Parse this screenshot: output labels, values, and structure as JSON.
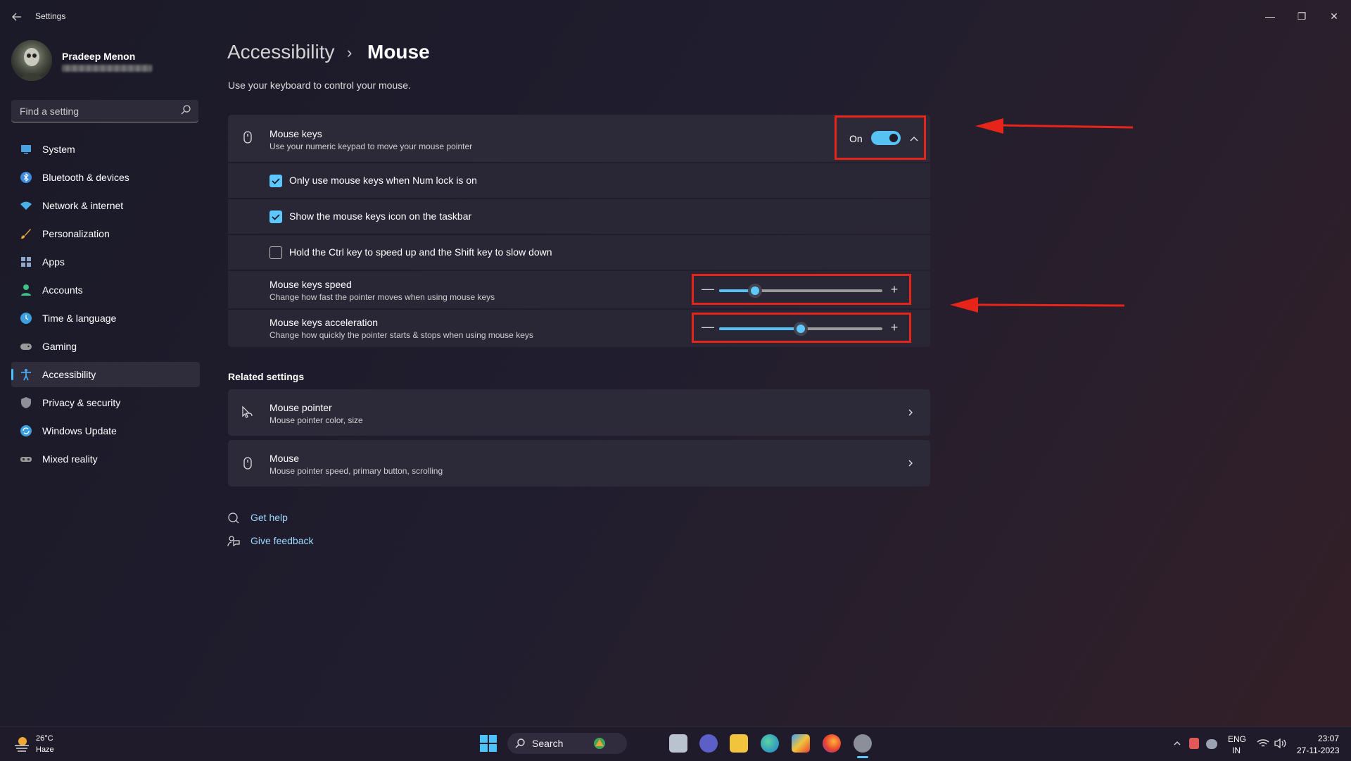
{
  "window": {
    "title": "Settings",
    "controls": {
      "minimize": "—",
      "maximize": "❐",
      "close": "✕"
    }
  },
  "profile": {
    "name": "Pradeep Menon"
  },
  "search": {
    "placeholder": "Find a setting"
  },
  "sidebar": {
    "items": [
      {
        "label": "System",
        "icon": "system-icon",
        "color": "#4aa3e0"
      },
      {
        "label": "Bluetooth & devices",
        "icon": "bluetooth-icon",
        "color": "#3d8be0"
      },
      {
        "label": "Network & internet",
        "icon": "wifi-icon",
        "color": "#4ab0e8"
      },
      {
        "label": "Personalization",
        "icon": "brush-icon",
        "color": "#e8a04a"
      },
      {
        "label": "Apps",
        "icon": "apps-icon",
        "color": "#8fa7c9"
      },
      {
        "label": "Accounts",
        "icon": "accounts-icon",
        "color": "#3fc087"
      },
      {
        "label": "Time & language",
        "icon": "globe-clock-icon",
        "color": "#3d9fe0"
      },
      {
        "label": "Gaming",
        "icon": "gamepad-icon",
        "color": "#9a9a9a"
      },
      {
        "label": "Accessibility",
        "icon": "accessibility-icon",
        "color": "#4aa8f0"
      },
      {
        "label": "Privacy & security",
        "icon": "shield-icon",
        "color": "#8f8f9a"
      },
      {
        "label": "Windows Update",
        "icon": "update-icon",
        "color": "#3d9fe0"
      },
      {
        "label": "Mixed reality",
        "icon": "headset-icon",
        "color": "#9a9a9a"
      }
    ],
    "active_index": 8
  },
  "header": {
    "breadcrumb_parent": "Accessibility",
    "breadcrumb_separator": "›",
    "breadcrumb_current": "Mouse",
    "description": "Use your keyboard to control your mouse."
  },
  "mouse_keys": {
    "title": "Mouse keys",
    "description": "Use your numeric keypad to move your mouse pointer",
    "toggle_state": "On",
    "toggle_on": true,
    "options": [
      {
        "label": "Only use mouse keys when Num lock is on",
        "checked": true
      },
      {
        "label": "Show the mouse keys icon on the taskbar",
        "checked": true
      },
      {
        "label": "Hold the Ctrl key to speed up and the Shift key to slow down",
        "checked": false
      }
    ],
    "speed": {
      "title": "Mouse keys speed",
      "description": "Change how fast the pointer moves when using mouse keys",
      "value_fraction": 0.22
    },
    "acceleration": {
      "title": "Mouse keys acceleration",
      "description": "Change how quickly the pointer starts & stops when using mouse keys",
      "value_fraction": 0.5
    },
    "decrease_symbol": "—",
    "increase_symbol": "+"
  },
  "related": {
    "title": "Related settings",
    "items": [
      {
        "title": "Mouse pointer",
        "description": "Mouse pointer color, size",
        "icon": "mouse-pointer-icon"
      },
      {
        "title": "Mouse",
        "description": "Mouse pointer speed, primary button, scrolling",
        "icon": "mouse-icon"
      }
    ]
  },
  "help": {
    "get_help": "Get help",
    "give_feedback": "Give feedback"
  },
  "taskbar": {
    "weather_temp": "26°C",
    "weather_condition": "Haze",
    "search_label": "Search",
    "language_top": "ENG",
    "language_bottom": "IN",
    "time": "23:07",
    "date": "27-11-2023"
  },
  "colors": {
    "accent": "#5cc8ff",
    "annotation": "#e6241a"
  }
}
